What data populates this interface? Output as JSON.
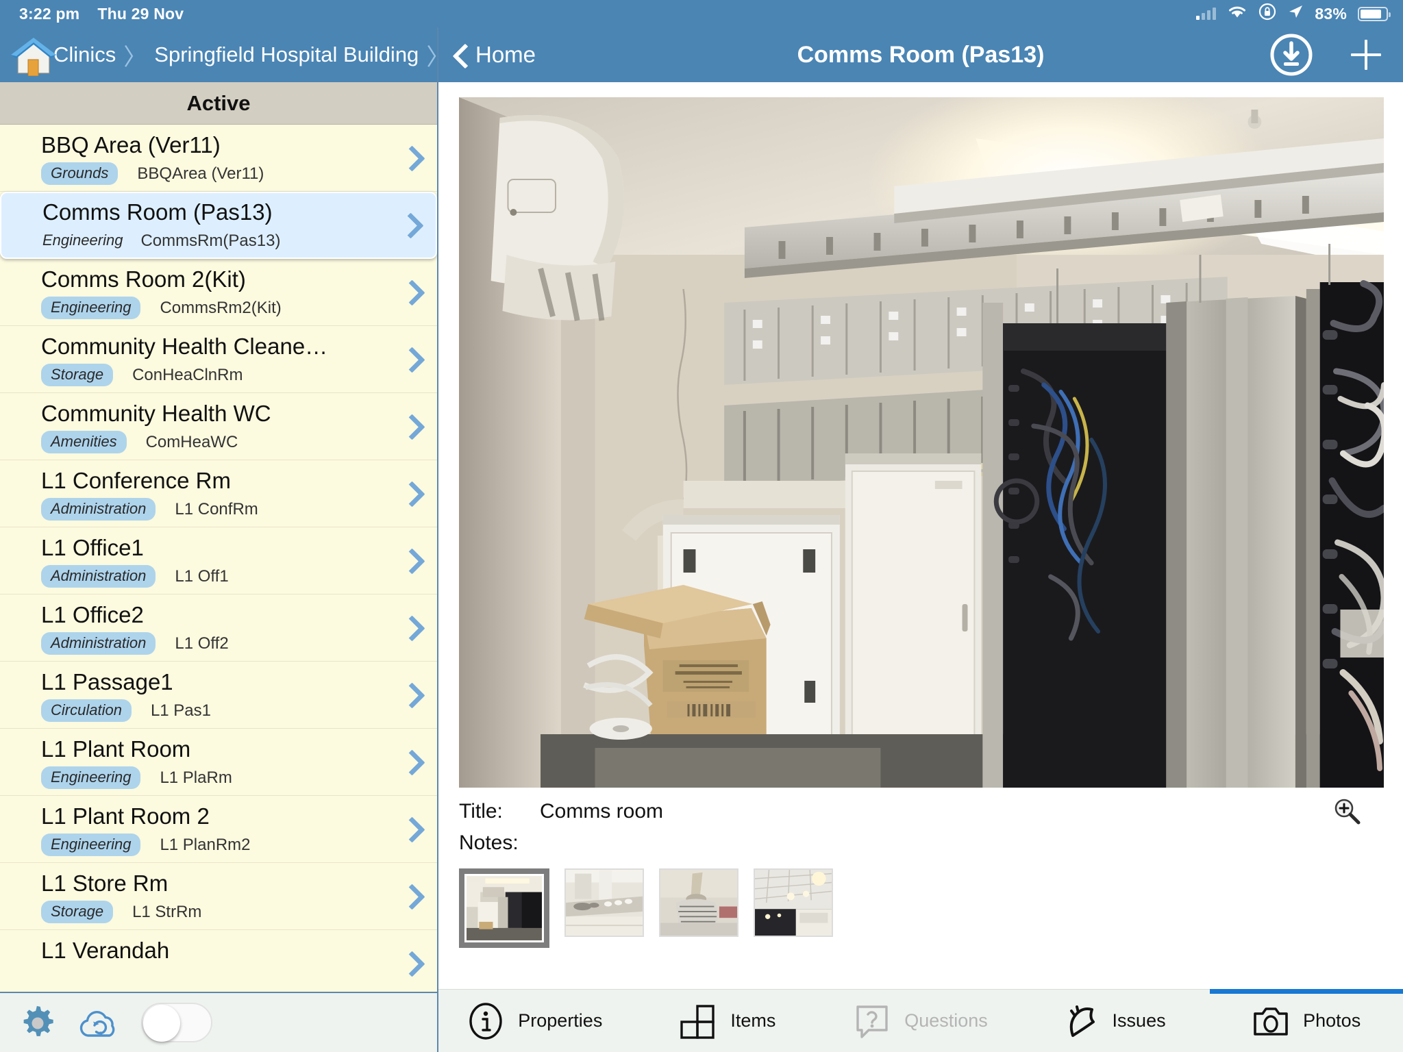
{
  "statusbar": {
    "time": "3:22 pm",
    "date": "Thu 29 Nov",
    "battery_percent": "83%",
    "icons": [
      "signal-icon",
      "wifi-icon",
      "rotation-lock-icon",
      "location-arrow-icon",
      "battery-icon"
    ]
  },
  "breadcrumb": {
    "home_icon": "house-icon",
    "items": [
      "Clinics",
      "Springfield Hospital Building"
    ],
    "separator": "〉"
  },
  "sidebar": {
    "header": "Active",
    "items": [
      {
        "title": "BBQ Area (Ver11)",
        "category": "Grounds",
        "code": "BBQArea (Ver11)",
        "selected": false
      },
      {
        "title": "Comms Room (Pas13)",
        "category": "Engineering",
        "code": "CommsRm(Pas13)",
        "selected": true
      },
      {
        "title": "Comms Room 2(Kit)",
        "category": "Engineering",
        "code": "CommsRm2(Kit)",
        "selected": false
      },
      {
        "title": "Community Health Cleane…",
        "category": "Storage",
        "code": "ConHeaClnRm",
        "selected": false
      },
      {
        "title": "Community Health WC",
        "category": "Amenities",
        "code": "ComHeaWC",
        "selected": false
      },
      {
        "title": "L1 Conference Rm",
        "category": "Administration",
        "code": "L1 ConfRm",
        "selected": false
      },
      {
        "title": "L1 Office1",
        "category": "Administration",
        "code": "L1 Off1",
        "selected": false
      },
      {
        "title": "L1 Office2",
        "category": "Administration",
        "code": "L1 Off2",
        "selected": false
      },
      {
        "title": "L1 Passage1",
        "category": "Circulation",
        "code": "L1 Pas1",
        "selected": false
      },
      {
        "title": "L1 Plant Room",
        "category": "Engineering",
        "code": "L1 PlaRm",
        "selected": false
      },
      {
        "title": "L1 Plant Room 2",
        "category": "Engineering",
        "code": "L1 PlanRm2",
        "selected": false
      },
      {
        "title": "L1 Store Rm",
        "category": "Storage",
        "code": "L1 StrRm",
        "selected": false
      },
      {
        "title": "L1 Verandah",
        "category": "",
        "code": "",
        "selected": false
      }
    ],
    "toolbar": {
      "settings_icon": "gear-icon",
      "sync_icon": "cloud-sync-icon",
      "toggle_state": "off"
    }
  },
  "navbar": {
    "back_label": "Home",
    "back_icon": "chevron-left-icon",
    "title": "Comms Room (Pas13)",
    "download_icon": "download-circle-icon",
    "add_icon": "plus-icon"
  },
  "detail": {
    "title_label": "Title:",
    "title_value": "Comms room",
    "notes_label": "Notes:",
    "notes_value": "",
    "magnify_icon": "magnifier-plus-icon"
  },
  "thumbnails": [
    {
      "name": "comms-room-racks",
      "selected": true
    },
    {
      "name": "ceiling-duct-stain",
      "selected": false
    },
    {
      "name": "ceiling-insulation",
      "selected": false
    },
    {
      "name": "corridor-ceiling",
      "selected": false
    }
  ],
  "tabs": [
    {
      "label": "Properties",
      "icon": "info-circle-icon",
      "active": false,
      "disabled": false
    },
    {
      "label": "Items",
      "icon": "blocks-icon",
      "active": false,
      "disabled": false
    },
    {
      "label": "Questions",
      "icon": "question-bubble-icon",
      "active": false,
      "disabled": true
    },
    {
      "label": "Issues",
      "icon": "flag-burst-icon",
      "active": false,
      "disabled": false
    },
    {
      "label": "Photos",
      "icon": "camera-icon",
      "active": true,
      "disabled": false
    }
  ],
  "colors": {
    "chrome_blue": "#4a85b4",
    "list_bg": "#fcfadf",
    "selected_row": "#ddefff",
    "pill": "#aed4ec",
    "active_tab_indicator": "#1878d2",
    "header_band": "#d2cec2"
  }
}
